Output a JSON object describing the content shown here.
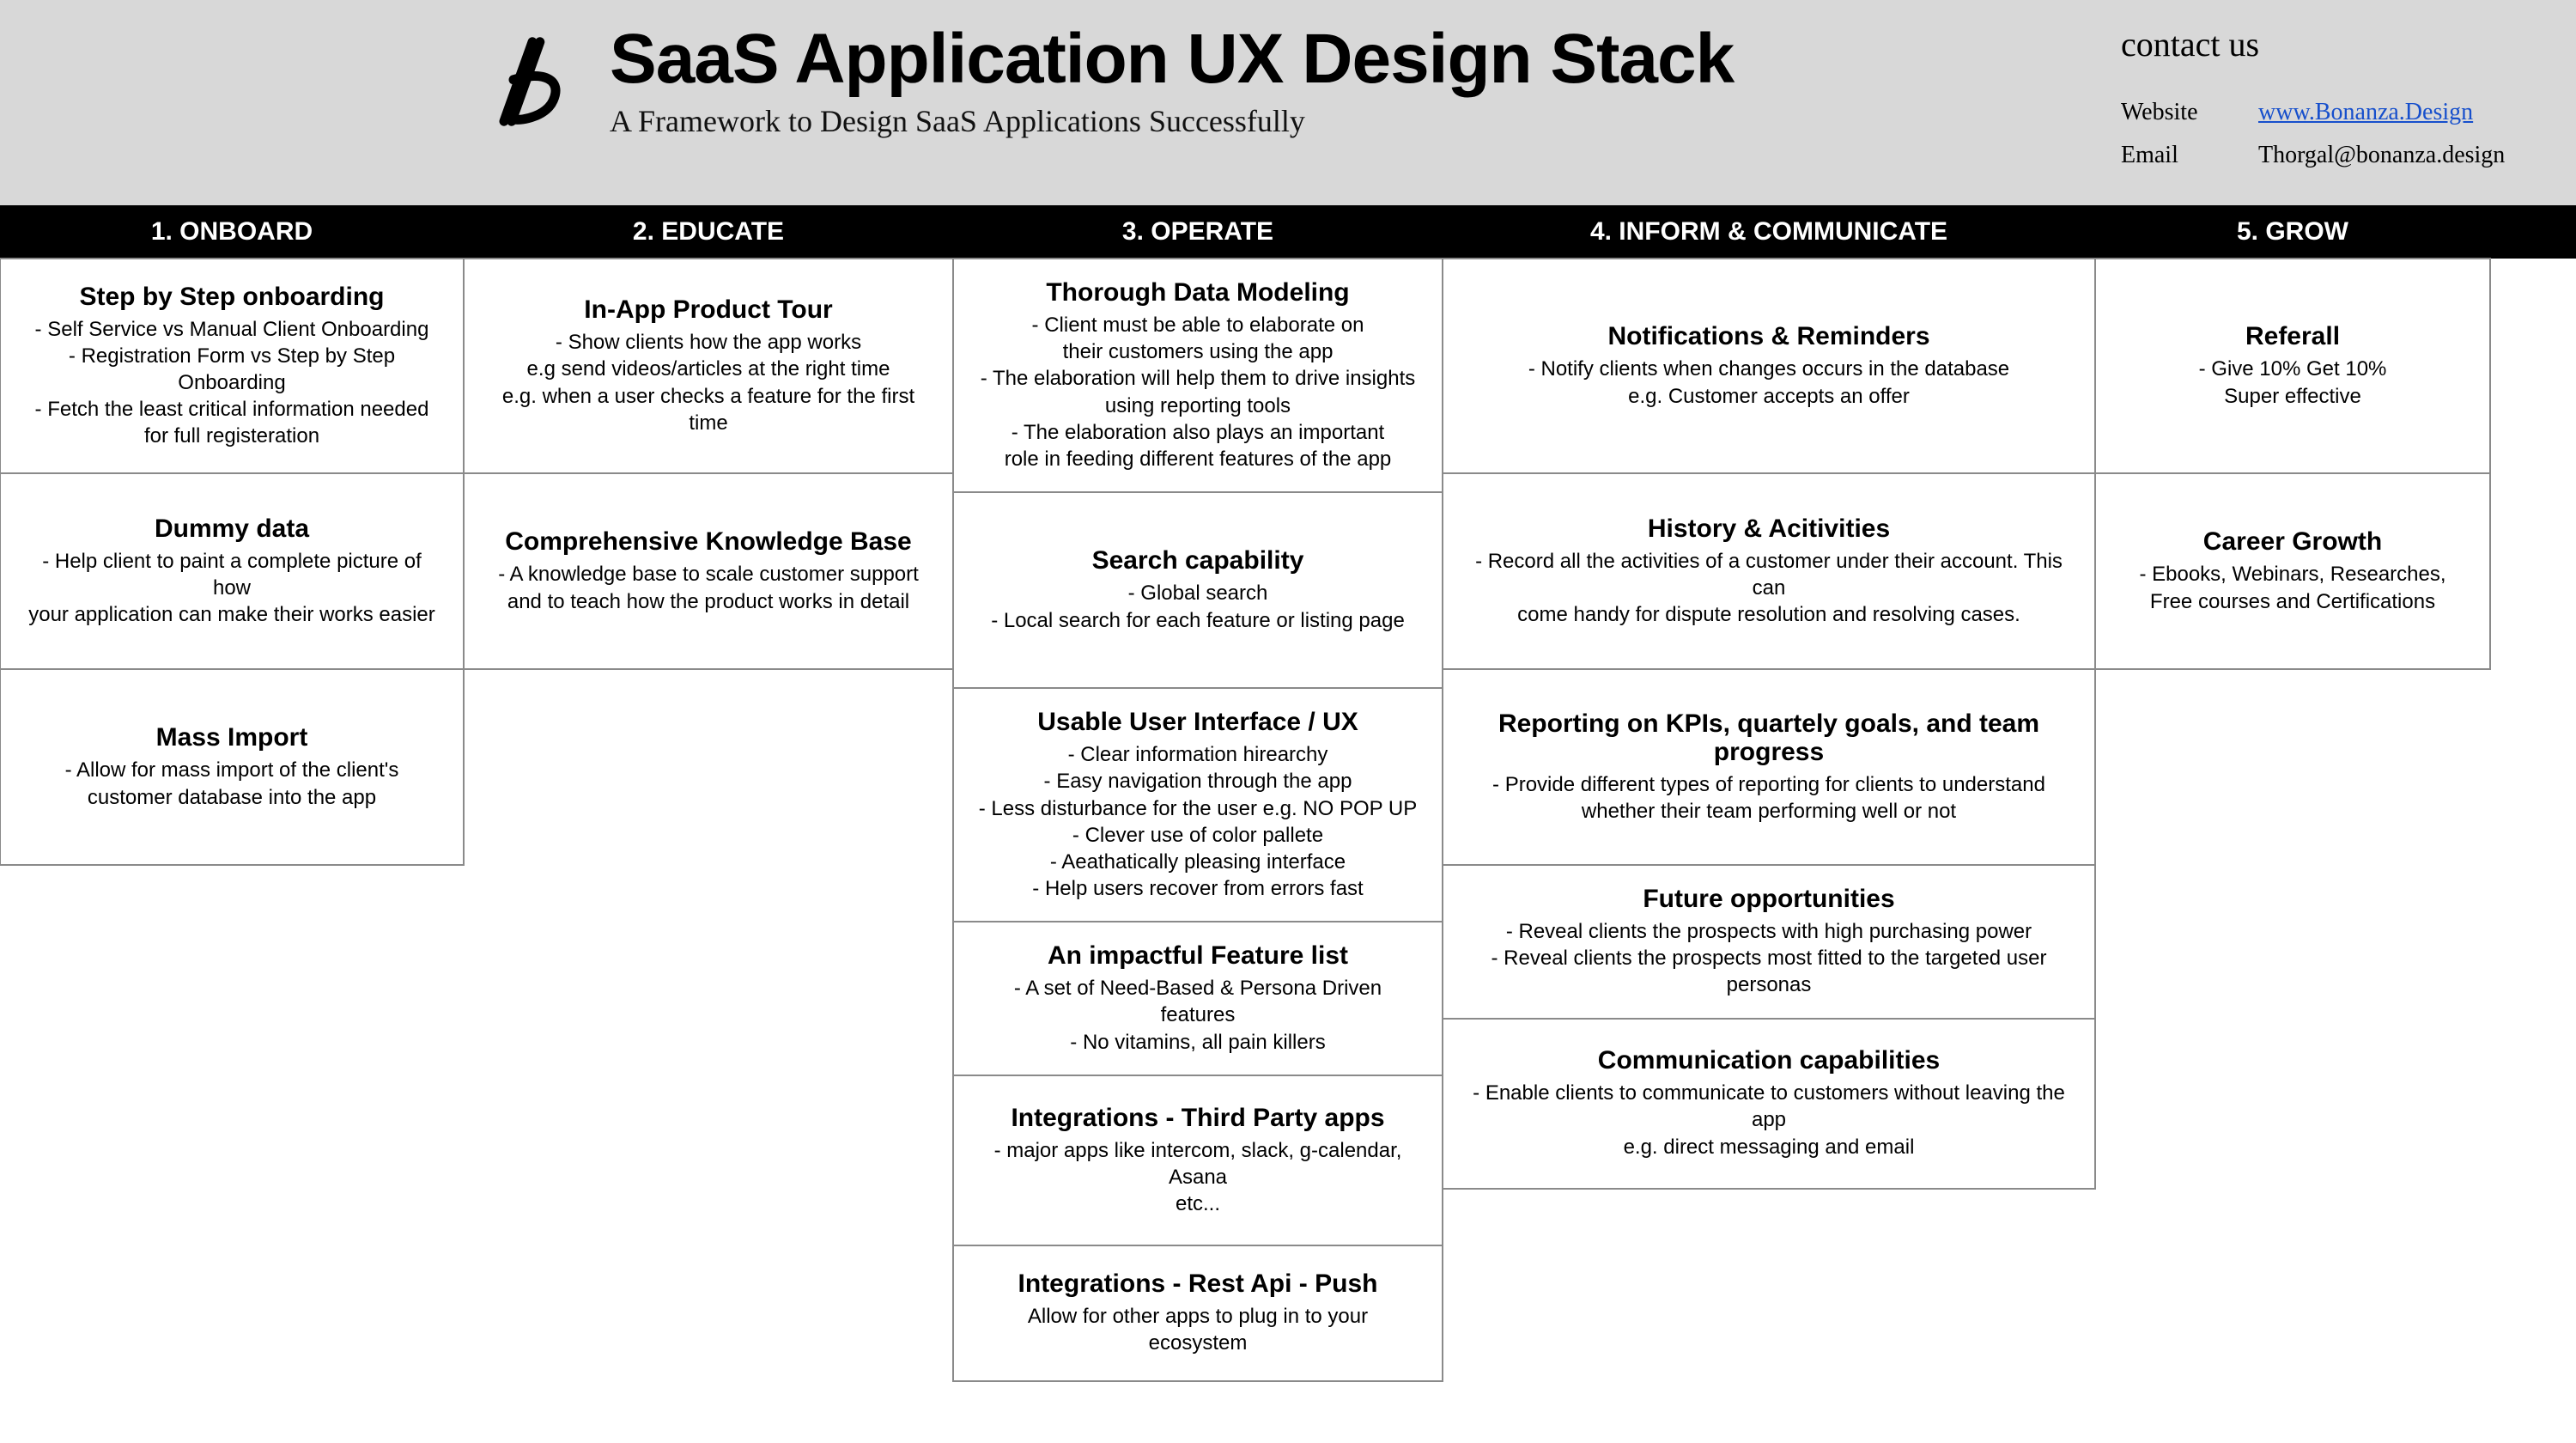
{
  "header": {
    "title": "SaaS Application UX Design Stack",
    "subtitle": "A Framework to Design SaaS Applications Successfully",
    "contact_heading": "contact us",
    "website_label": "Website",
    "website_value": "www.Bonanza.Design",
    "email_label": "Email",
    "email_value": "Thorgal@bonanza.design"
  },
  "columns": [
    {
      "label": "1. ONBOARD"
    },
    {
      "label": "2. EDUCATE"
    },
    {
      "label": "3. OPERATE"
    },
    {
      "label": "4. INFORM  & COMMUNICATE"
    },
    {
      "label": "5. GROW"
    }
  ],
  "grid": {
    "onboard": [
      {
        "title": "Step by Step onboarding",
        "lines": [
          "- Self Service vs Manual Client Onboarding",
          "- Registration Form vs Step by Step Onboarding",
          "- Fetch the least critical information needed",
          "for full registeration"
        ]
      },
      {
        "title": "Dummy data",
        "lines": [
          "- Help client to paint a complete picture of how",
          "your application can make their works easier"
        ]
      },
      {
        "title": "Mass Import",
        "lines": [
          "- Allow for mass import of the client's",
          "customer database into the app"
        ]
      }
    ],
    "educate": [
      {
        "title": "In-App Product Tour",
        "lines": [
          "- Show clients how the app works",
          "e.g send videos/articles at the right time",
          "e.g. when a user checks a feature for the first time"
        ]
      },
      {
        "title": "Comprehensive Knowledge Base",
        "lines": [
          "- A knowledge base to scale customer support",
          "and to teach how the product works in detail"
        ]
      }
    ],
    "operate": [
      {
        "title": "Thorough Data Modeling",
        "lines": [
          "- Client must be able to elaborate on",
          "their customers using the app",
          "- The elaboration will help them to drive insights",
          "using reporting tools",
          "- The elaboration also plays an important",
          "role in feeding different features of the app"
        ]
      },
      {
        "title": "Search capability",
        "lines": [
          "- Global search",
          "- Local search for each feature or listing page"
        ]
      },
      {
        "title": "Usable User Interface / UX",
        "lines": [
          "- Clear information hirearchy",
          "- Easy navigation through the app",
          "- Less disturbance for the user e.g. NO POP UP",
          "- Clever use of color pallete",
          "- Aeathatically pleasing interface",
          "- Help users recover from errors fast"
        ]
      },
      {
        "title": "An impactful Feature list",
        "lines": [
          "- A set of Need-Based & Persona Driven features",
          "- No vitamins, all pain killers"
        ]
      },
      {
        "title": "Integrations - Third Party apps",
        "lines": [
          "- major apps like intercom, slack, g-calendar, Asana",
          "etc..."
        ]
      },
      {
        "title": "Integrations - Rest Api - Push",
        "lines": [
          "Allow for other apps to plug in to your",
          "ecosystem"
        ]
      }
    ],
    "inform": [
      {
        "title": "Notifications & Reminders",
        "lines": [
          "- Notify clients when changes occurs in the database",
          "e.g. Customer accepts an offer"
        ]
      },
      {
        "title": "History & Acitivities",
        "lines": [
          "- Record all the activities of a customer under their account. This can",
          "come handy for dispute resolution and resolving cases."
        ]
      },
      {
        "title": "Reporting on KPIs, quartely goals,  and team progress",
        "lines": [
          "- Provide different types of reporting for clients to understand",
          "whether their team performing well or not"
        ]
      },
      {
        "title": "Future opportunities",
        "lines": [
          "- Reveal clients the prospects with high purchasing power",
          "- Reveal clients the prospects most fitted to the targeted user personas"
        ]
      },
      {
        "title": "Communication capabilities",
        "lines": [
          "- Enable clients to communicate to customers without leaving the app",
          "e.g. direct messaging and email"
        ]
      }
    ],
    "grow": [
      {
        "title": "Referall",
        "lines": [
          "- Give 10% Get 10%",
          "Super effective"
        ]
      },
      {
        "title": "Career Growth",
        "lines": [
          "- Ebooks, Webinars, Researches,",
          "Free courses and Certifications"
        ]
      }
    ]
  }
}
